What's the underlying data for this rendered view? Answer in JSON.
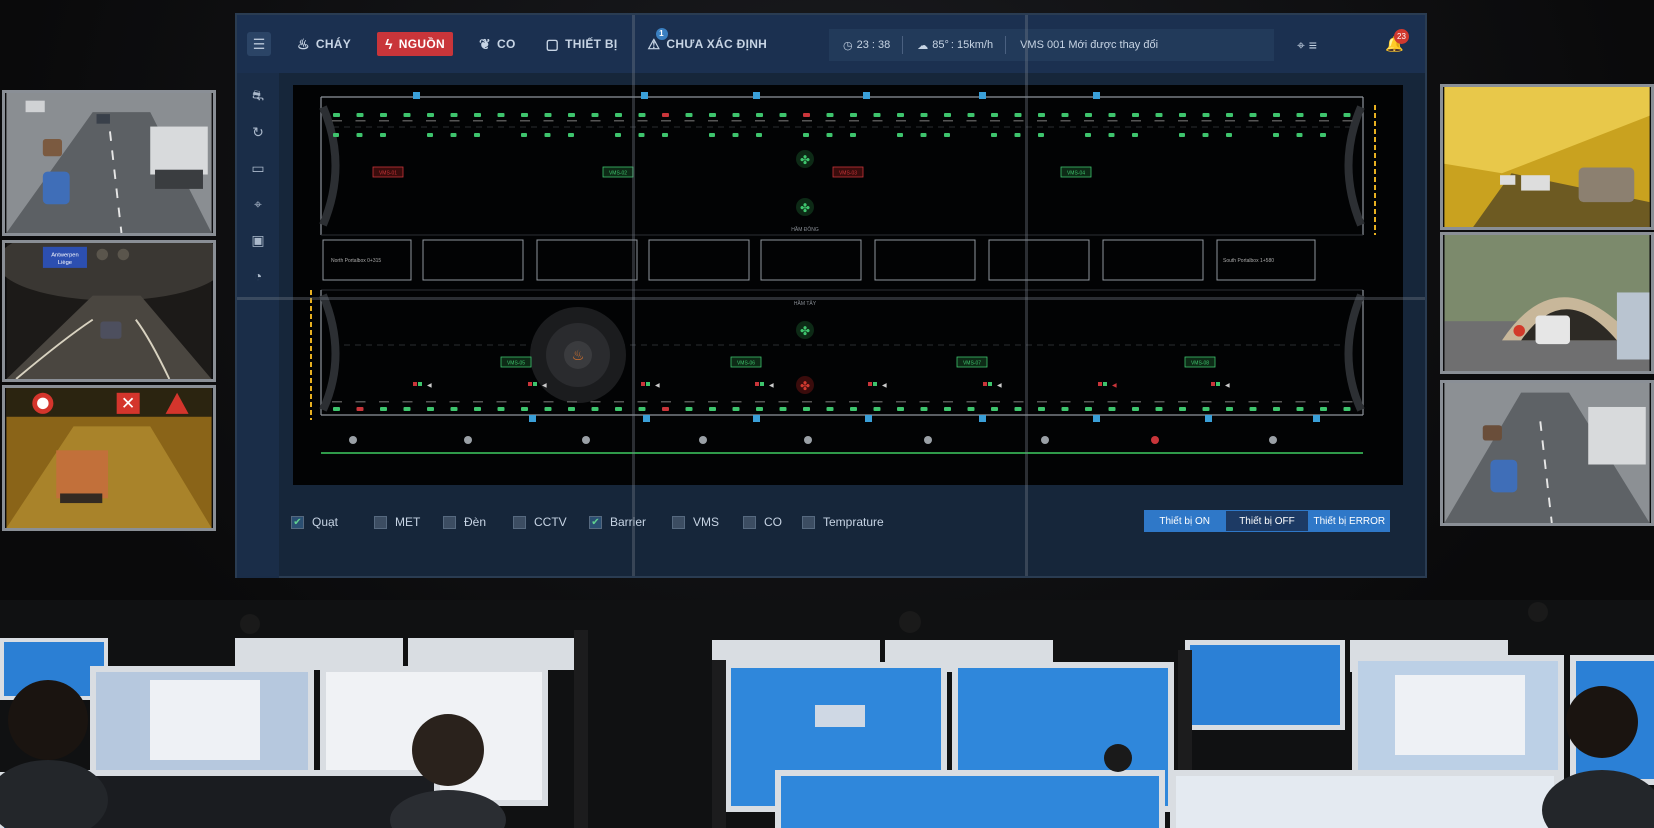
{
  "header": {
    "menu_icon": "hamburger-icon",
    "tabs": [
      {
        "label": "CHÁY",
        "icon": "fire-icon",
        "active": false
      },
      {
        "label": "NGUỒN",
        "icon": "lightning-icon",
        "active": true
      },
      {
        "label": "CO",
        "icon": "leaf-icon",
        "active": false
      },
      {
        "label": "THIẾT BỊ",
        "icon": "device-icon",
        "active": false
      },
      {
        "label": "CHƯA XÁC ĐỊNH",
        "icon": "warning-icon",
        "active": false,
        "badge": "1"
      }
    ],
    "status": {
      "time": "23 : 38",
      "weather": "85°",
      "wind": ": 15km/h",
      "vms": "VMS 001 Mới được thay đổi"
    },
    "notifications": "23"
  },
  "map": {
    "zone_label_top": "HẦM ĐÔNG",
    "zone_label_bottom": "HẦM TÂY",
    "left_box": "North Portalbox 0+315",
    "right_box": "South Portalbox 1+580",
    "vms_signs_top": [
      "VMS-01",
      "VMS-02",
      "VMS-03",
      "VMS-04"
    ],
    "vms_signs_bottom": [
      "VMS-05",
      "VMS-06",
      "VMS-07",
      "VMS-08"
    ]
  },
  "filters": [
    {
      "label": "Quạt",
      "checked": true
    },
    {
      "label": "MET",
      "checked": false
    },
    {
      "label": "Đèn",
      "checked": false
    },
    {
      "label": "CCTV",
      "checked": false
    },
    {
      "label": "Barrier",
      "checked": true
    },
    {
      "label": "VMS",
      "checked": false
    },
    {
      "label": "CO",
      "checked": false
    },
    {
      "label": "Temprature",
      "checked": false
    }
  ],
  "legend": {
    "on": "Thiết bị ON",
    "off": "Thiết bị OFF",
    "error": "Thiết bị ERROR"
  },
  "cams": {
    "sign_text": "Antwerpen\nLiège"
  },
  "colors": {
    "accent": "#2f78c8",
    "danger": "#c9353a",
    "ok": "#3ec46d",
    "warn": "#e8b020"
  }
}
